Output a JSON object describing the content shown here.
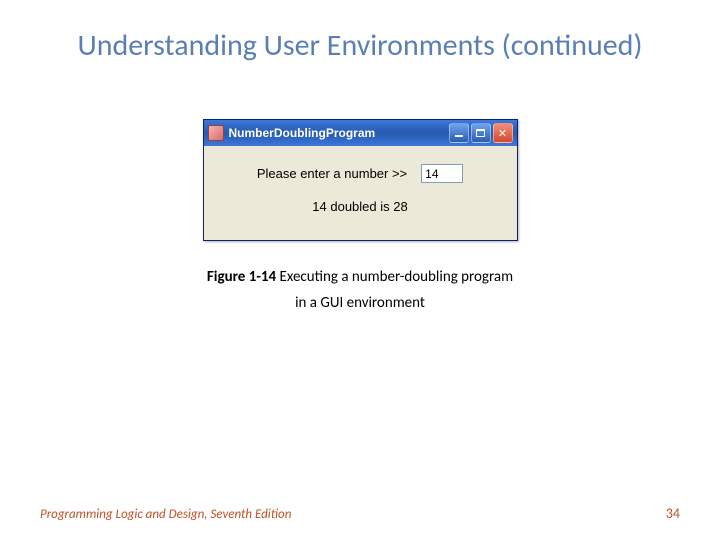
{
  "title": "Understanding User Environments (continued)",
  "window": {
    "title": "NumberDoublingProgram",
    "prompt": "Please enter a number >>",
    "input_value": "14",
    "result": "14 doubled is 28"
  },
  "figure": {
    "number": "Figure 1-14",
    "text_line1": " Executing a number-doubling program",
    "text_line2": "in a GUI environment"
  },
  "footer": {
    "book": "Programming Logic and Design, Seventh Edition",
    "page": "34"
  }
}
